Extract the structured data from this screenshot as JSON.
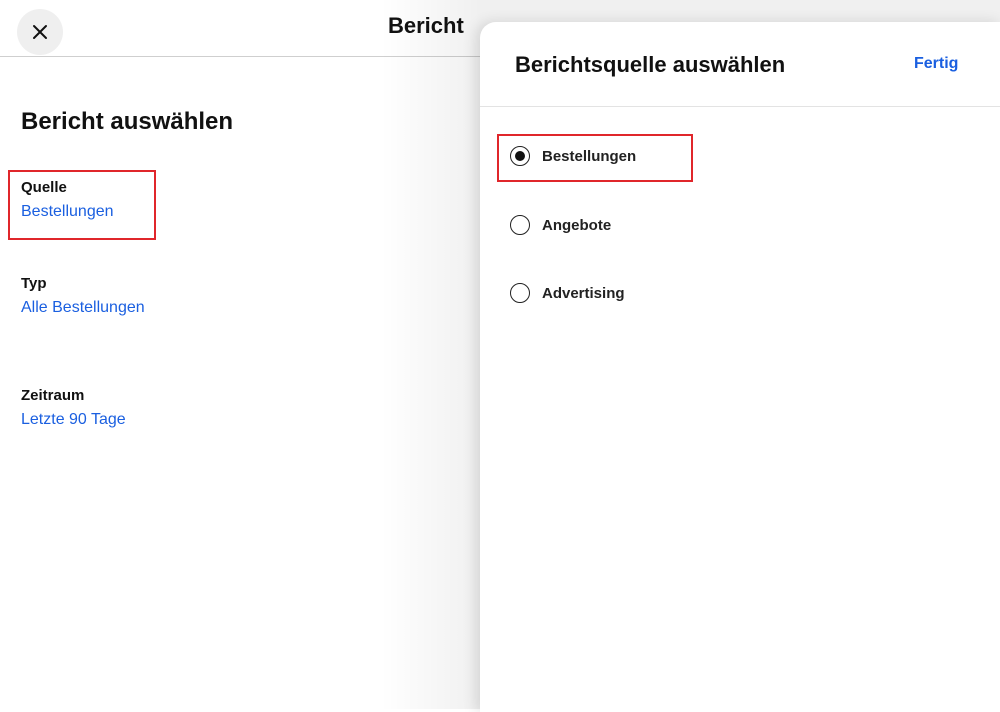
{
  "page": {
    "title": "Bericht",
    "heading": "Bericht auswählen"
  },
  "settings": [
    {
      "label": "Quelle",
      "value": "Bestellungen"
    },
    {
      "label": "Typ",
      "value": "Alle Bestellungen"
    },
    {
      "label": "Zeitraum",
      "value": "Letzte 90 Tage"
    }
  ],
  "panel": {
    "title": "Berichtsquelle auswählen",
    "done_label": "Fertig",
    "options": [
      {
        "label": "Bestellungen",
        "selected": true
      },
      {
        "label": "Angebote",
        "selected": false
      },
      {
        "label": "Advertising",
        "selected": false
      }
    ]
  },
  "icons": {
    "close": "close-icon",
    "chevron": "chevron-right-icon"
  },
  "colors": {
    "link_blue": "#1a5fe0",
    "highlight_red": "#e0262b"
  }
}
